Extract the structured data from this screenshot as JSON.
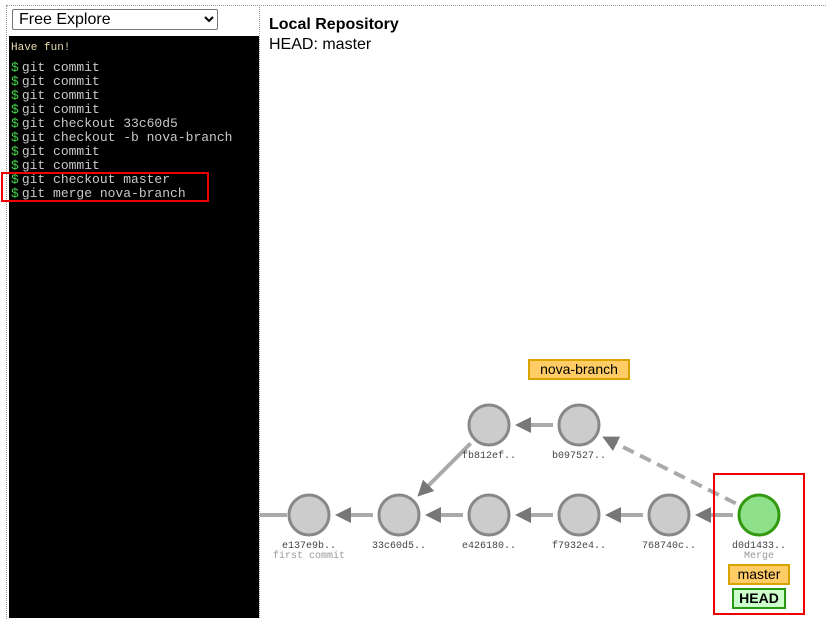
{
  "mode_select": {
    "selected": "Free Explore"
  },
  "terminal": {
    "welcome": "Have fun!",
    "prompt_symbol": "$",
    "commands": [
      "git commit",
      "git commit",
      "git commit",
      "git commit",
      "git checkout 33c60d5",
      "git checkout -b nova-branch",
      "git commit",
      "git commit",
      "git checkout master",
      "git merge nova-branch"
    ]
  },
  "repository": {
    "title": "Local Repository",
    "head_label": "HEAD: master"
  },
  "graph": {
    "commits": [
      {
        "id": "e137e9b..",
        "message": "first commit",
        "col": 0,
        "row": 1,
        "type": "normal"
      },
      {
        "id": "33c60d5..",
        "message": "",
        "col": 1,
        "row": 1,
        "type": "normal"
      },
      {
        "id": "e426180..",
        "message": "",
        "col": 2,
        "row": 1,
        "type": "normal"
      },
      {
        "id": "f7932e4..",
        "message": "",
        "col": 3,
        "row": 1,
        "type": "normal"
      },
      {
        "id": "768740c..",
        "message": "",
        "col": 4,
        "row": 1,
        "type": "normal"
      },
      {
        "id": "d0d1433..",
        "message": "Merge",
        "col": 5,
        "row": 1,
        "type": "head"
      },
      {
        "id": "fb812ef..",
        "message": "",
        "col": 2,
        "row": 0,
        "type": "normal"
      },
      {
        "id": "b097527..",
        "message": "",
        "col": 3,
        "row": 0,
        "type": "normal"
      }
    ],
    "edges": [
      {
        "from": 1,
        "to": 0,
        "style": "solid"
      },
      {
        "from": 2,
        "to": 1,
        "style": "solid"
      },
      {
        "from": 3,
        "to": 2,
        "style": "solid"
      },
      {
        "from": 4,
        "to": 3,
        "style": "solid"
      },
      {
        "from": 5,
        "to": 4,
        "style": "solid"
      },
      {
        "from": 6,
        "to": 1,
        "style": "solid"
      },
      {
        "from": 7,
        "to": 6,
        "style": "solid"
      },
      {
        "from": 5,
        "to": 7,
        "style": "dashed"
      }
    ],
    "branches": [
      {
        "name": "nova-branch",
        "commit": 7
      },
      {
        "name": "master",
        "commit": 5
      }
    ],
    "head": {
      "label": "HEAD",
      "commit": 5
    },
    "colors": {
      "node_fill": "#cccccc",
      "node_stroke": "#888888",
      "head_fill": "#8fe08a",
      "head_stroke": "#339911",
      "edge": "#aaaaaa",
      "arrow": "#777777",
      "highlight": "#e00000"
    }
  }
}
